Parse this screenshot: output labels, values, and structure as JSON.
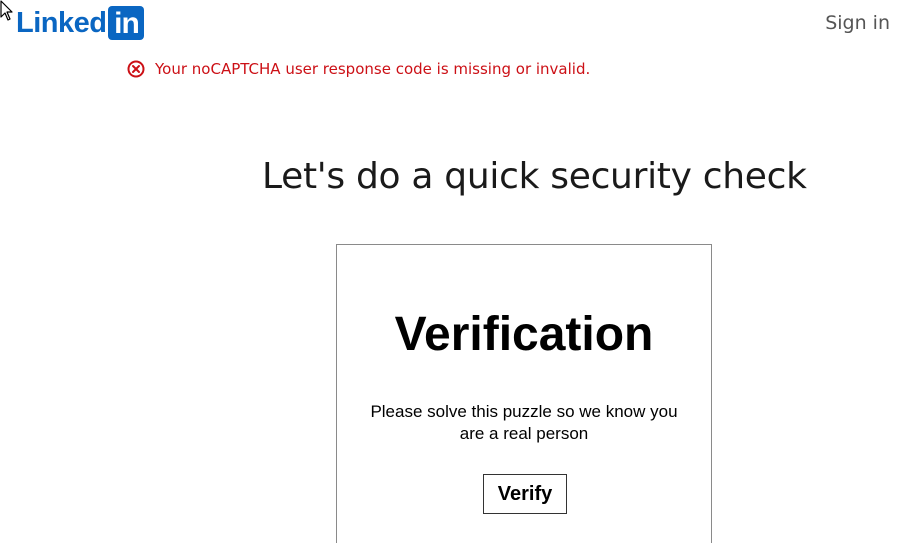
{
  "header": {
    "logo_word": "Linked",
    "logo_box": "in",
    "sign_in_label": "Sign in"
  },
  "error": {
    "icon": "error-circle-x-icon",
    "message": "Your noCAPTCHA user response code is missing or invalid."
  },
  "main": {
    "title": "Let's do a quick security check"
  },
  "card": {
    "heading": "Verification",
    "instructions": "Please solve this puzzle so we know you are a real person",
    "verify_label": "Verify"
  },
  "colors": {
    "brand": "#0a66c2",
    "error": "#cc1016",
    "sign_in": "#555555"
  }
}
